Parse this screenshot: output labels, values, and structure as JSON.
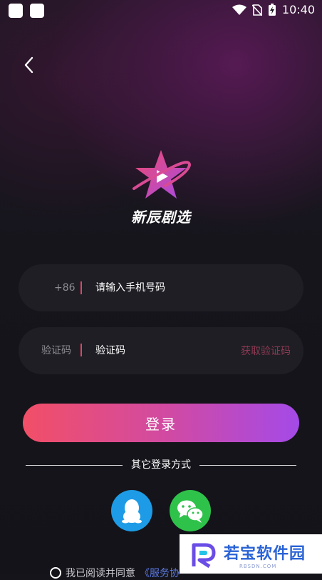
{
  "status_bar": {
    "time": "10:40"
  },
  "app": {
    "brand_name": "新辰剧选"
  },
  "phone_field": {
    "prefix": "+86",
    "placeholder": "请输入手机号码"
  },
  "code_field": {
    "label": "验证码",
    "placeholder": "验证码",
    "get_code": "获取验证码"
  },
  "login_button": {
    "label": "登录"
  },
  "other_login": {
    "title": "其它登录方式",
    "providers": [
      "qq-icon",
      "wechat-icon"
    ]
  },
  "agreement": {
    "text": "我已阅读并同意",
    "link": "《服务协"
  },
  "watermark": {
    "title": "若宝软件园",
    "subtitle": "RBSDN.COM"
  },
  "colors": {
    "accent_red": "#e0456a",
    "login_gradient_start": "#f24f67",
    "login_gradient_end": "#a44ae8",
    "qq": "#1d9be6",
    "wechat": "#2fc24a"
  }
}
